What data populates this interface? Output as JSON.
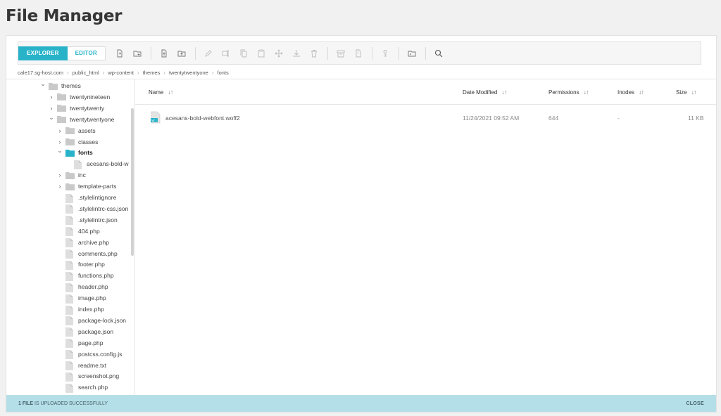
{
  "page": {
    "title": "File Manager"
  },
  "toolbar": {
    "explorer_label": "EXPLORER",
    "editor_label": "EDITOR",
    "icons": [
      "new-file-icon",
      "new-folder-icon",
      "upload-file-icon",
      "upload-folder-icon",
      "edit-icon",
      "rename-icon",
      "copy-icon",
      "paste-icon",
      "move-icon",
      "download-icon",
      "delete-icon",
      "archive-icon",
      "extract-icon",
      "permissions-icon",
      "open-folder-icon",
      "search-icon"
    ]
  },
  "breadcrumb": [
    "cale17.sg-host.com",
    "public_html",
    "wp-content",
    "themes",
    "twentytwentyone",
    "fonts"
  ],
  "tree": {
    "items": [
      {
        "label": "themes",
        "type": "folder",
        "state": "open"
      },
      {
        "label": "twentynineteen",
        "type": "folder",
        "state": "closed"
      },
      {
        "label": "twentytwenty",
        "type": "folder",
        "state": "closed"
      },
      {
        "label": "twentytwentyone",
        "type": "folder",
        "state": "open"
      },
      {
        "label": "assets",
        "type": "folder",
        "state": "closed"
      },
      {
        "label": "classes",
        "type": "folder",
        "state": "closed"
      },
      {
        "label": "fonts",
        "type": "folder",
        "state": "open",
        "active": true
      },
      {
        "label": "acesans-bold-w",
        "type": "file"
      },
      {
        "label": "inc",
        "type": "folder",
        "state": "closed"
      },
      {
        "label": "template-parts",
        "type": "folder",
        "state": "closed"
      },
      {
        "label": ".stylelintignore",
        "type": "file"
      },
      {
        "label": ".stylelintrc-css.json",
        "type": "file"
      },
      {
        "label": ".stylelintrc.json",
        "type": "file"
      },
      {
        "label": "404.php",
        "type": "file"
      },
      {
        "label": "archive.php",
        "type": "file"
      },
      {
        "label": "comments.php",
        "type": "file"
      },
      {
        "label": "footer.php",
        "type": "file"
      },
      {
        "label": "functions.php",
        "type": "file"
      },
      {
        "label": "header.php",
        "type": "file"
      },
      {
        "label": "image.php",
        "type": "file"
      },
      {
        "label": "index.php",
        "type": "file"
      },
      {
        "label": "package-lock.json",
        "type": "file"
      },
      {
        "label": "package.json",
        "type": "file"
      },
      {
        "label": "page.php",
        "type": "file"
      },
      {
        "label": "postcss.config.js",
        "type": "file"
      },
      {
        "label": "readme.txt",
        "type": "file"
      },
      {
        "label": "screenshot.png",
        "type": "file"
      },
      {
        "label": "search.php",
        "type": "file"
      }
    ]
  },
  "list": {
    "columns": {
      "name": "Name",
      "date": "Date Modified",
      "perms": "Permissions",
      "inodes": "Inodes",
      "size": "Size"
    },
    "rows": [
      {
        "name": "acesans-bold-webfont.woff2",
        "icon_text": "W...",
        "date": "11/24/2021 09:52 AM",
        "perms": "644",
        "inodes": "-",
        "size": "11 KB"
      }
    ]
  },
  "status": {
    "count": "1 FILE",
    "message": " IS UPLOADED SUCCESSFULLY",
    "close_label": "CLOSE"
  },
  "colors": {
    "accent": "#28b3c9",
    "status_bg": "#b5dfe8",
    "folder": "#c9c9c9",
    "folder_active": "#28b3c9"
  }
}
